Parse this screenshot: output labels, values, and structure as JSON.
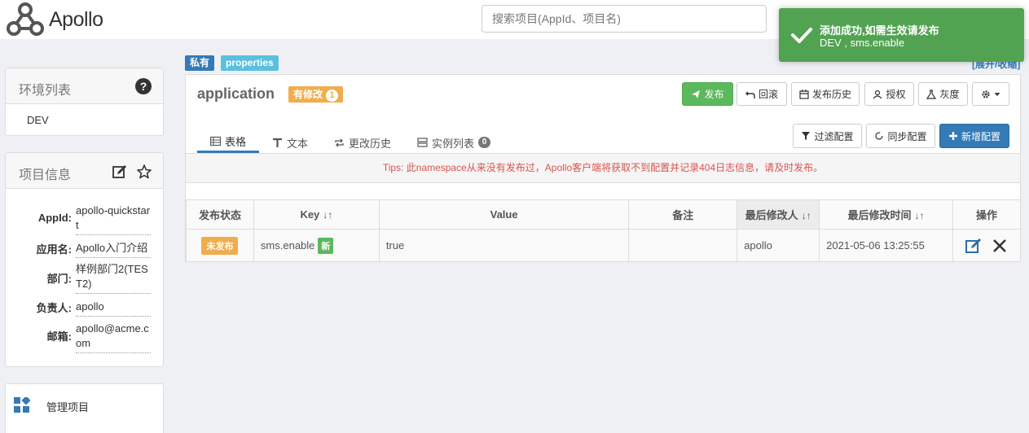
{
  "header": {
    "logo_text": "Apollo",
    "search_placeholder": "搜索项目(AppId、项目名)"
  },
  "toast": {
    "title": "添加成功,如需生效请发布",
    "message": "DEV , sms.enable",
    "color": "#51a351"
  },
  "sidebar": {
    "env_title": "环境列表",
    "env_items": [
      "DEV"
    ],
    "project_title": "项目信息",
    "project_info": [
      {
        "label": "AppId:",
        "value": "apollo-quickstart"
      },
      {
        "label": "应用名:",
        "value": "Apollo入门介绍"
      },
      {
        "label": "部门:",
        "value": "样例部门2(TEST2)"
      },
      {
        "label": "负责人:",
        "value": "apollo"
      },
      {
        "label": "邮箱:",
        "value": "apollo@acme.com"
      }
    ],
    "manage_label": "管理项目"
  },
  "namespace": {
    "tag_private": "私有",
    "tag_format": "properties",
    "expand_label": "[展开/收缩]",
    "title": "application",
    "modified_badge": "有修改",
    "modified_count": "1",
    "buttons": {
      "publish": "发布",
      "rollback": "回滚",
      "history": "发布历史",
      "authorize": "授权",
      "gray": "灰度"
    },
    "tabs": {
      "table": "表格",
      "text": "文本",
      "change_history": "更改历史",
      "instances": "实例列表",
      "instances_count": "0"
    },
    "actions": {
      "filter": "过滤配置",
      "sync": "同步配置",
      "add": "新增配置"
    },
    "tips": "Tips: 此namespace从来没有发布过，Apollo客户端将获取不到配置并记录404日志信息，请及时发布。",
    "table": {
      "headers": {
        "status": "发布状态",
        "key": "Key",
        "value": "Value",
        "comment": "备注",
        "modifier": "最后修改人",
        "modified_time": "最后修改时间",
        "ops": "操作"
      },
      "rows": [
        {
          "status": "未发布",
          "key": "sms.enable",
          "new_label": "新",
          "value": "true",
          "comment": "",
          "modifier": "apollo",
          "modified_time": "2021-05-06 13:25:55"
        }
      ]
    }
  },
  "colors": {
    "primary": "#337ab7",
    "success": "#5cb85c",
    "warning": "#f0ad4e",
    "danger": "#d9534f",
    "info": "#5bc0de"
  }
}
